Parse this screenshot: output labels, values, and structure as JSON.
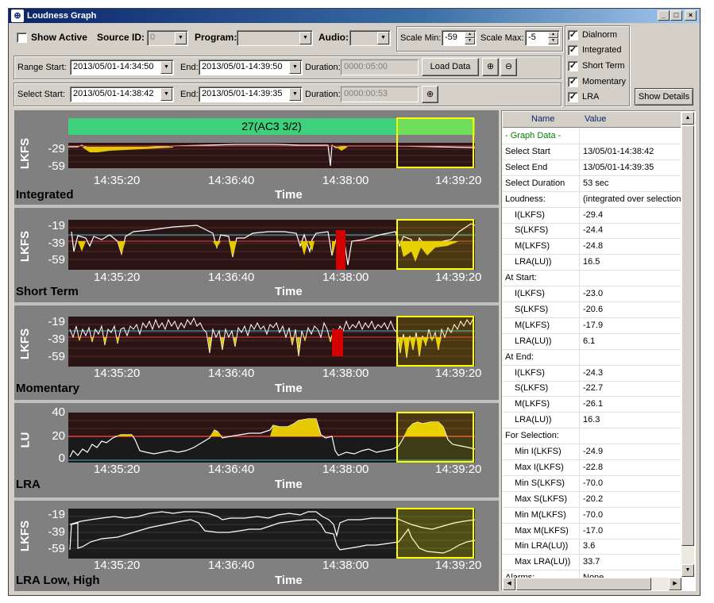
{
  "window": {
    "title": "Loudness Graph",
    "min": "_",
    "max": "□",
    "close": "×"
  },
  "toolbar1": {
    "show_active": "Show Active",
    "source_id_label": "Source ID:",
    "source_id_value": "0",
    "program_label": "Program:",
    "program_value": "",
    "audio_label": "Audio:",
    "audio_value": "",
    "scale_min_label": "Scale Min:",
    "scale_min_value": "-59",
    "scale_max_label": "Scale Max:",
    "scale_max_value": "-5"
  },
  "toolbar2": {
    "range_start_label": "Range Start:",
    "range_start_value": "2013/05/01-14:34:50",
    "end_label": "End:",
    "end_value": "2013/05/01-14:39:50",
    "duration_label": "Duration:",
    "duration_value": "0000:05:00",
    "load_data": "Load Data"
  },
  "toolbar3": {
    "select_start_label": "Select Start:",
    "select_start_value": "2013/05/01-14:38:42",
    "end_label": "End:",
    "end_value": "2013/05/01-14:39:35",
    "duration_label": "Duration:",
    "duration_value": "0000:00:53"
  },
  "options": {
    "dialnorm": "Dialnorm",
    "integrated": "Integrated",
    "short_term": "Short Term",
    "momentary": "Momentary",
    "lra": "LRA",
    "show_details": "Show Details"
  },
  "graphs": {
    "xaxis_label": "Time",
    "xticks": [
      "14:35:20",
      "14:36:40",
      "14:38:00",
      "14:39:20"
    ],
    "integrated": {
      "title": "Integrated",
      "ylabel": "LKFS",
      "yticks": [
        "-29",
        "-59"
      ],
      "banner": "27(AC3 3/2)"
    },
    "short_term": {
      "title": "Short Term",
      "ylabel": "LKFS",
      "yticks": [
        "-19",
        "-39",
        "-59"
      ]
    },
    "momentary": {
      "title": "Momentary",
      "ylabel": "LKFS",
      "yticks": [
        "-19",
        "-39",
        "-59"
      ]
    },
    "lra": {
      "title": "LRA",
      "ylabel": "LU",
      "yticks": [
        "40",
        "20",
        "0"
      ]
    },
    "lra_low_high": {
      "title": "LRA Low, High",
      "ylabel": "LKFS",
      "yticks": [
        "-19",
        "-39",
        "-59"
      ]
    }
  },
  "colors": {
    "plot_bg": "#2a1414",
    "fill": "#e6c800",
    "alarm": "#d40000",
    "selection": "#ffff00",
    "banner": "#3ed07a"
  },
  "details": {
    "col_name": "Name",
    "col_value": "Value",
    "rows": [
      {
        "n": "- Graph Data -",
        "v": ""
      },
      {
        "n": "Select Start",
        "v": "13/05/01-14:38:42"
      },
      {
        "n": "Select End",
        "v": "13/05/01-14:39:35"
      },
      {
        "n": "Select Duration",
        "v": "53 sec"
      },
      {
        "n": "Loudness:",
        "v": "(integrated over selection)"
      },
      {
        "n": "I(LKFS)",
        "v": "-29.4"
      },
      {
        "n": "S(LKFS)",
        "v": "-24.4"
      },
      {
        "n": "M(LKFS)",
        "v": "-24.8"
      },
      {
        "n": "LRA(LU))",
        "v": "16.5"
      },
      {
        "n": "At Start:",
        "v": ""
      },
      {
        "n": "I(LKFS)",
        "v": "-23.0"
      },
      {
        "n": "S(LKFS)",
        "v": "-20.6"
      },
      {
        "n": "M(LKFS)",
        "v": "-17.9"
      },
      {
        "n": "LRA(LU))",
        "v": "6.1"
      },
      {
        "n": "At End:",
        "v": ""
      },
      {
        "n": "I(LKFS)",
        "v": "-24.3"
      },
      {
        "n": "S(LKFS)",
        "v": "-22.7"
      },
      {
        "n": "M(LKFS)",
        "v": "-26.1"
      },
      {
        "n": "LRA(LU))",
        "v": "16.3"
      },
      {
        "n": "For Selection:",
        "v": ""
      },
      {
        "n": "Min I(LKFS)",
        "v": "-24.9"
      },
      {
        "n": "Max I(LKFS)",
        "v": "-22.8"
      },
      {
        "n": "Min S(LKFS)",
        "v": "-70.0"
      },
      {
        "n": "Max S(LKFS)",
        "v": "-20.2"
      },
      {
        "n": "Min M(LKFS)",
        "v": "-70.0"
      },
      {
        "n": "Max M(LKFS)",
        "v": "-17.0"
      },
      {
        "n": "Min LRA(LU))",
        "v": "3.6"
      },
      {
        "n": "Max LRA(LU))",
        "v": "33.7"
      },
      {
        "n": "Alarms:",
        "v": "None"
      }
    ]
  }
}
